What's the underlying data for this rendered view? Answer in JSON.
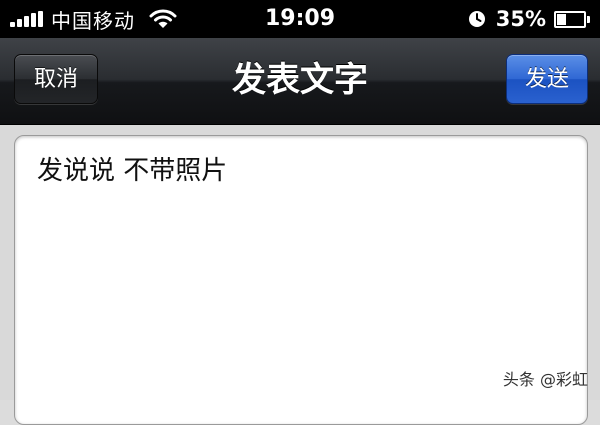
{
  "status_bar": {
    "carrier": "中国移动",
    "time": "19:09",
    "battery_percent": "35%",
    "battery_level": 0.35,
    "icons": [
      "signal-icon",
      "wifi-icon",
      "clock-icon",
      "battery-icon"
    ]
  },
  "nav_bar": {
    "title": "发表文字",
    "cancel_label": "取消",
    "send_label": "发送",
    "send_color": "#2f67d4"
  },
  "editor": {
    "value": "发说说 不带照片"
  },
  "watermark": "头条 @彩虹"
}
